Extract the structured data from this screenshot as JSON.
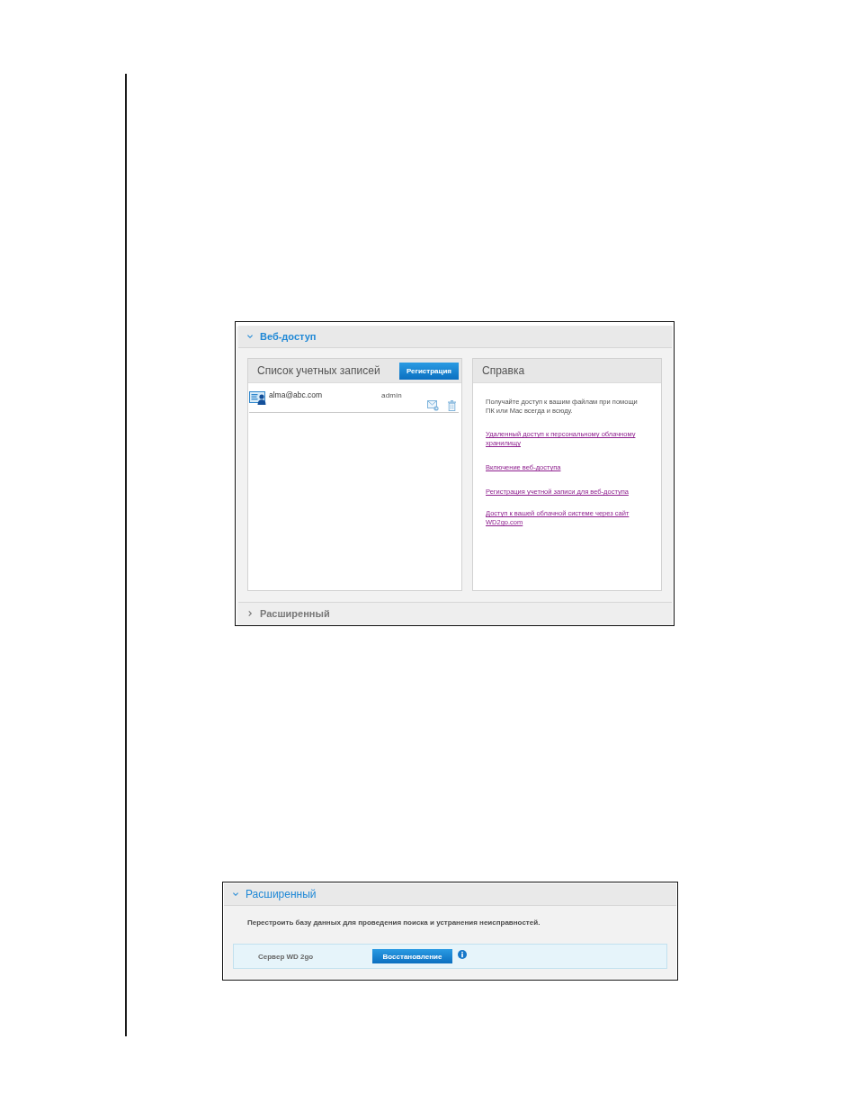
{
  "web_access_screen": {
    "sections": [
      {
        "title": "Веб-доступ",
        "expanded": true,
        "accounts_panel": {
          "title": "Список учетных записей",
          "button": "Регистрация",
          "rows": [
            {
              "email": "alma@abc.com",
              "role": "admin"
            }
          ]
        },
        "help_panel": {
          "title": "Справка",
          "text": "Получайте доступ к вашим файлам при помощи ПК или Mac всегда и всюду.",
          "links": [
            "Удаленный доступ к персональному облачному хранилищу",
            "Включение веб-доступа",
            "Регистрация учетной записи для веб-доступа",
            "Доступ к вашей облачной системе через сайт WD2go.com"
          ]
        }
      },
      {
        "title": "Расширенный",
        "expanded": false
      }
    ]
  },
  "advanced_screen": {
    "sections": [
      {
        "title": "Расширенный",
        "expanded": true,
        "description": "Перестроить базу данных для проведения поиска и устранения неисправностей.",
        "rows": [
          {
            "label": "Сервер WD 2go",
            "button": "Восстановление"
          }
        ]
      }
    ]
  }
}
